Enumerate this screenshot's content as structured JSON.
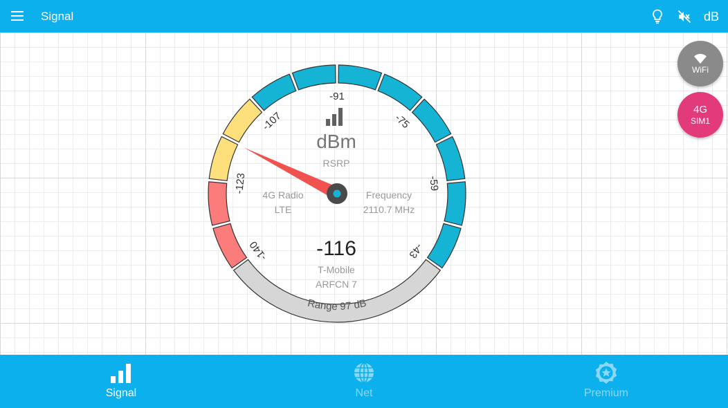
{
  "topbar": {
    "title": "Signal",
    "db_label": "dB"
  },
  "fabs": {
    "wifi_label": "WiFi",
    "sim_tech": "4G",
    "sim_label": "SIM1"
  },
  "gauge": {
    "unit": "dBm",
    "metric": "RSRP",
    "value": "-116",
    "value_numeric": -116,
    "min": -140,
    "max": -43,
    "ticks": [
      "-140",
      "-123",
      "-107",
      "-91",
      "-75",
      "-59",
      "-43"
    ],
    "radio_label": "4G Radio",
    "radio_type": "LTE",
    "frequency_label": "Frequency",
    "frequency_value": "2110.7 MHz",
    "operator": "T-Mobile",
    "arfcn": "ARFCN 7",
    "range_label": "Range 97 dB",
    "colors": {
      "red": "#fb7c7a",
      "yellow": "#fde07c",
      "cyan": "#15b4d4",
      "gray": "#d6d6d6",
      "needle": "#f0524f",
      "hub": "#4a4a4a",
      "hub_center": "#15b4d4"
    }
  },
  "bottom_nav": {
    "items": [
      {
        "label": "Signal",
        "icon": "signal-bars-icon",
        "active": true
      },
      {
        "label": "Net",
        "icon": "globe-icon",
        "active": false
      },
      {
        "label": "Premium",
        "icon": "badge-star-icon",
        "active": false
      }
    ]
  },
  "colors": {
    "primary": "#0bb0ec",
    "inactive_nav": "#8ad8f6"
  }
}
